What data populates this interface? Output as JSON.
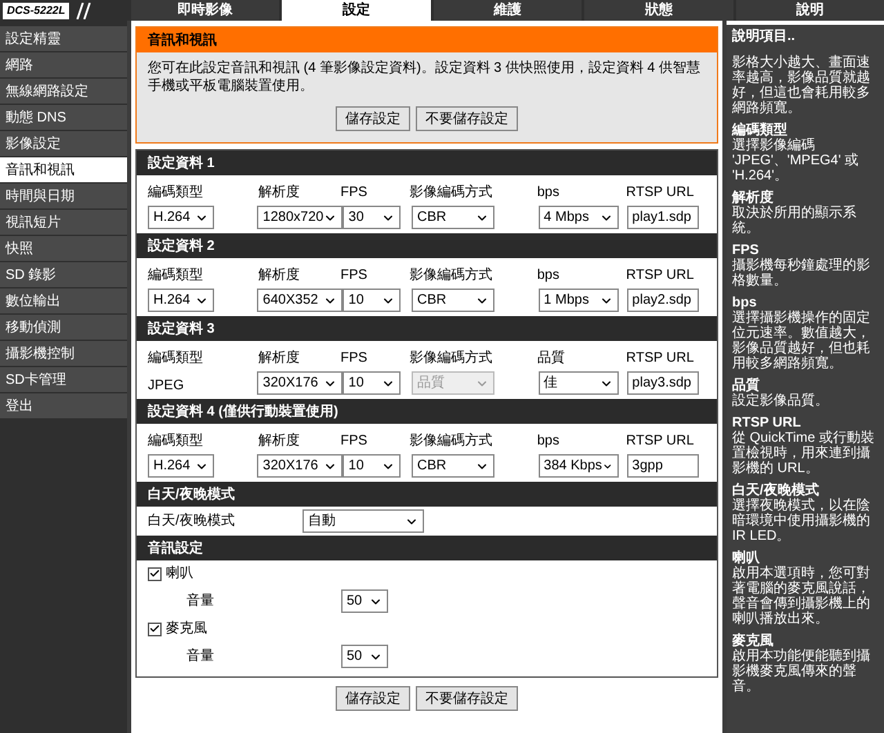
{
  "logo": "DCS-5222L",
  "tabs": [
    {
      "label": "即時影像",
      "selected": false
    },
    {
      "label": "設定",
      "selected": true
    },
    {
      "label": "維護",
      "selected": false
    },
    {
      "label": "狀態",
      "selected": false
    },
    {
      "label": "說明",
      "selected": false
    }
  ],
  "sidebar": {
    "items": [
      {
        "label": "設定精靈",
        "selected": false
      },
      {
        "label": "網路",
        "selected": false
      },
      {
        "label": "無線網路設定",
        "selected": false
      },
      {
        "label": "動態 DNS",
        "selected": false
      },
      {
        "label": "影像設定",
        "selected": false
      },
      {
        "label": "音訊和視訊",
        "selected": true
      },
      {
        "label": "時間與日期",
        "selected": false
      },
      {
        "label": "視訊短片",
        "selected": false
      },
      {
        "label": "快照",
        "selected": false
      },
      {
        "label": "SD 錄影",
        "selected": false
      },
      {
        "label": "數位輸出",
        "selected": false
      },
      {
        "label": "移動偵測",
        "selected": false
      },
      {
        "label": "攝影機控制",
        "selected": false
      },
      {
        "label": "SD卡管理",
        "selected": false
      },
      {
        "label": "登出",
        "selected": false
      }
    ]
  },
  "intro": {
    "title": "音訊和視訊",
    "text": "您可在此設定音訊和視訊 (4 筆影像設定資料)。設定資料 3 供快照使用，設定資料 4 供智慧手機或平板電腦裝置使用。",
    "buttons": [
      "儲存設定",
      "不要儲存設定"
    ]
  },
  "profiles": [
    {
      "title": "設定資料 1",
      "fields": [
        {
          "label": "編碼類型",
          "kind": "select",
          "value": "H.264",
          "disabled": false
        },
        {
          "label": "解析度",
          "kind": "select",
          "value": "1280x720",
          "disabled": false
        },
        {
          "label": "FPS",
          "kind": "select",
          "value": "30",
          "disabled": false
        },
        {
          "label": "影像編碼方式",
          "kind": "select",
          "value": "CBR",
          "disabled": false
        },
        {
          "label": "bps",
          "kind": "select",
          "value": "4 Mbps",
          "disabled": false
        },
        {
          "label": "RTSP URL",
          "kind": "input",
          "value": "play1.sdp"
        }
      ]
    },
    {
      "title": "設定資料 2",
      "fields": [
        {
          "label": "編碼類型",
          "kind": "select",
          "value": "H.264",
          "disabled": false
        },
        {
          "label": "解析度",
          "kind": "select",
          "value": "640X352",
          "disabled": false
        },
        {
          "label": "FPS",
          "kind": "select",
          "value": "10",
          "disabled": false
        },
        {
          "label": "影像編碼方式",
          "kind": "select",
          "value": "CBR",
          "disabled": false
        },
        {
          "label": "bps",
          "kind": "select",
          "value": "1 Mbps",
          "disabled": false
        },
        {
          "label": "RTSP URL",
          "kind": "input",
          "value": "play2.sdp"
        }
      ]
    },
    {
      "title": "設定資料 3",
      "fields": [
        {
          "label": "編碼類型",
          "kind": "text",
          "value": "JPEG"
        },
        {
          "label": "解析度",
          "kind": "select",
          "value": "320X176",
          "disabled": false
        },
        {
          "label": "FPS",
          "kind": "select",
          "value": "10",
          "disabled": false
        },
        {
          "label": "影像編碼方式",
          "kind": "select",
          "value": "品質",
          "disabled": true
        },
        {
          "label": "品質",
          "kind": "select",
          "value": "佳",
          "disabled": false
        },
        {
          "label": "RTSP URL",
          "kind": "input",
          "value": "play3.sdp"
        }
      ]
    },
    {
      "title": "設定資料 4 (僅供行動裝置使用)",
      "fields": [
        {
          "label": "編碼類型",
          "kind": "select",
          "value": "H.264",
          "disabled": false
        },
        {
          "label": "解析度",
          "kind": "select",
          "value": "320X176",
          "disabled": false
        },
        {
          "label": "FPS",
          "kind": "select",
          "value": "10",
          "disabled": false
        },
        {
          "label": "影像編碼方式",
          "kind": "select",
          "value": "CBR",
          "disabled": false
        },
        {
          "label": "bps",
          "kind": "select",
          "value": "384 Kbps",
          "disabled": false
        },
        {
          "label": "RTSP URL",
          "kind": "input",
          "value": "3gpp"
        }
      ]
    }
  ],
  "day_night": {
    "title": "白天/夜晚模式",
    "label": "白天/夜晚模式",
    "value": "自動"
  },
  "audio": {
    "title": "音訊設定",
    "items": [
      {
        "label": "喇叭",
        "checked": true,
        "volume_label": "音量",
        "volume": "50"
      },
      {
        "label": "麥克風",
        "checked": true,
        "volume_label": "音量",
        "volume": "50"
      }
    ]
  },
  "buttons": [
    "儲存設定",
    "不要儲存設定"
  ],
  "help": {
    "title": "說明項目..",
    "intro": "影格大小越大、畫面速率越高，影像品質就越好，但這也會耗用較多網路頻寬。",
    "items": [
      {
        "title": "編碼類型",
        "text": "選擇影像編碼 'JPEG'、'MPEG4' 或 'H.264'。"
      },
      {
        "title": "解析度",
        "text": "取決於所用的顯示系統。"
      },
      {
        "title": "FPS",
        "text": "攝影機每秒鐘處理的影格數量。"
      },
      {
        "title": "bps",
        "text": "選擇攝影機操作的固定位元速率。數值越大，影像品質越好，但也耗用較多網路頻寬。"
      },
      {
        "title": "品質",
        "text": "設定影像品質。"
      },
      {
        "title": "RTSP URL",
        "text": "從 QuickTime 或行動裝置檢視時，用來連到攝影機的 URL。"
      },
      {
        "title": "白天/夜晚模式",
        "text": "選擇夜晚模式，以在陰暗環境中使用攝影機的 IR LED。"
      },
      {
        "title": "喇叭",
        "text": "啟用本選項時，您可對著電腦的麥克風說話，聲音會傳到攝影機上的喇叭播放出來。"
      },
      {
        "title": "麥克風",
        "text": "啟用本功能便能聽到攝影機麥克風傳來的聲音。"
      }
    ]
  }
}
